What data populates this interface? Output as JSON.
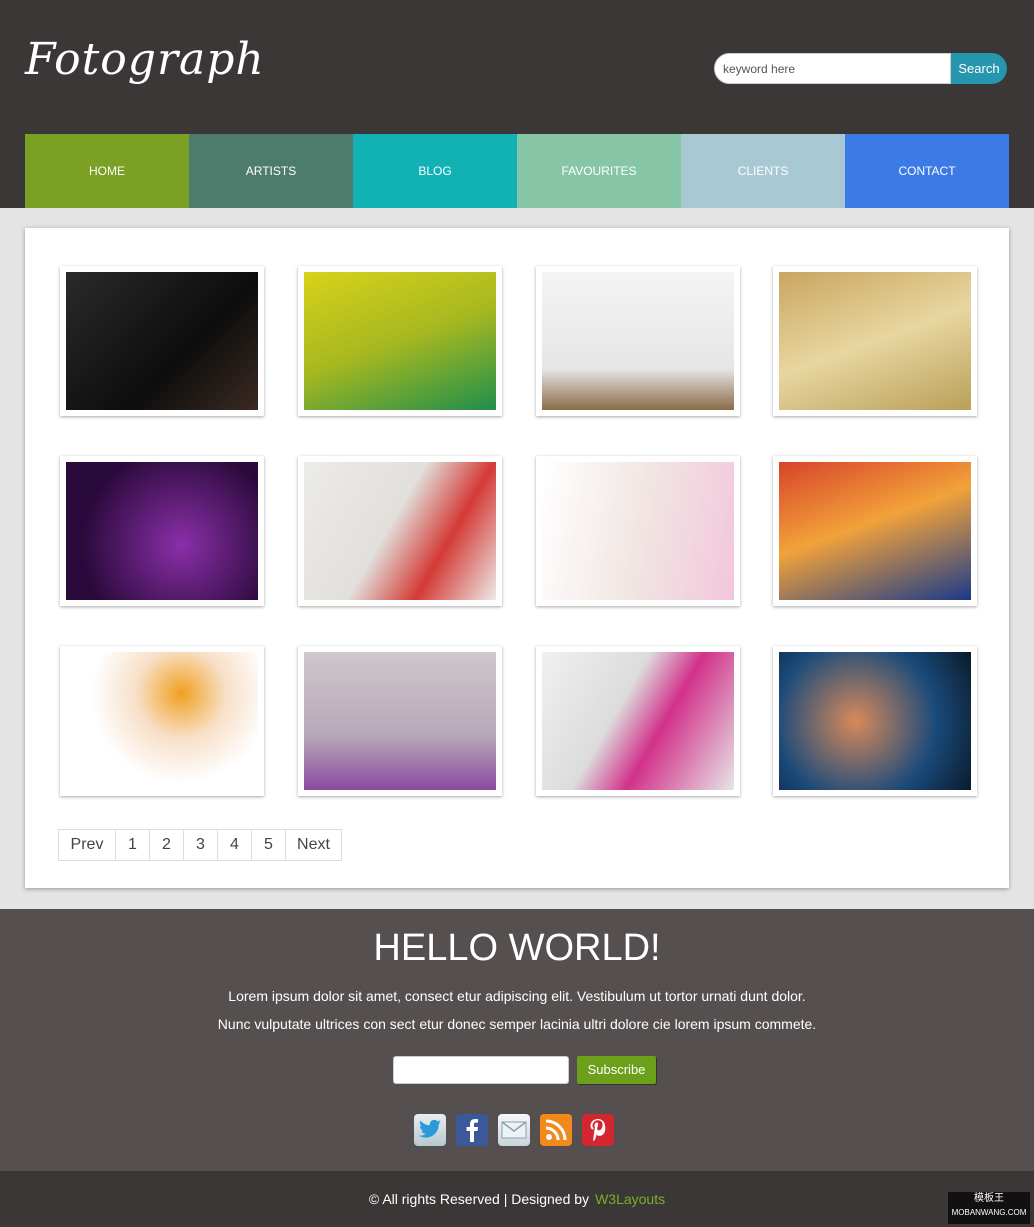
{
  "header": {
    "logo": "Fotograph",
    "search": {
      "placeholder": "keyword here",
      "button": "Search"
    }
  },
  "nav": {
    "items": [
      {
        "label": "HOME",
        "color": "#7aa123"
      },
      {
        "label": "ARTISTS",
        "color": "#4e7c6c"
      },
      {
        "label": "BLOG",
        "color": "#12b2b4"
      },
      {
        "label": "FAVOURITES",
        "color": "#86c6a6"
      },
      {
        "label": "CLIENTS",
        "color": "#a8c8d4"
      },
      {
        "label": "CONTACT",
        "color": "#3c7ae6"
      }
    ]
  },
  "gallery": {
    "photo_count": 12
  },
  "pagination": {
    "prev": "Prev",
    "pages": [
      "1",
      "2",
      "3",
      "4",
      "5"
    ],
    "next": "Next"
  },
  "footer": {
    "heading": "HELLO WORLD!",
    "line1": "Lorem ipsum dolor sit amet, consect etur adipiscing elit. Vestibulum ut tortor urnati dunt dolor.",
    "line2": "Nunc vulputate ultrices con sect etur donec semper lacinia ultri dolore cie lorem ipsum commete.",
    "subscribe": "Subscribe",
    "social": [
      "twitter-icon",
      "facebook-icon",
      "email-icon",
      "rss-icon",
      "pinterest-icon"
    ],
    "copyright": "© All rights Reserved | Designed by",
    "designer": "W3Layouts",
    "watermark_top": "模板王",
    "watermark_bottom": "MOBANWANG.COM"
  },
  "colors": {
    "accent_green": "#7aae2a",
    "search_blue": "#2596ae",
    "dark_bg": "#3b3737",
    "footer_bg": "#554f4f"
  }
}
